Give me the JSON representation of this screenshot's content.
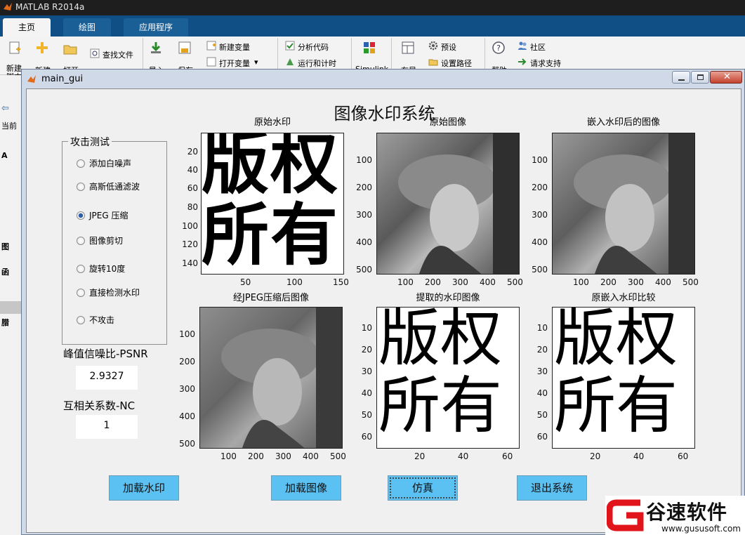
{
  "app": {
    "title": "MATLAB R2014a"
  },
  "ribbon": {
    "tabs": [
      "主页",
      "绘图",
      "应用程序"
    ],
    "items": {
      "new_script": "新建\n脚本",
      "new": "新建",
      "open": "打开",
      "find_files": "查找文件",
      "import": "导入",
      "save": "保存",
      "new_variable": "新建变量",
      "open_variable": "打开变量",
      "analyze_code": "分析代码",
      "run_time": "运行和计时",
      "simulink": "Simulink",
      "layout": "布局",
      "preferences": "预设",
      "set_path": "设置路径",
      "help": "帮助",
      "community": "社区",
      "request_support": "请求支持"
    }
  },
  "side": {
    "current": "当前",
    "a": "A",
    "fig": "图",
    "fn": "函",
    "bad": "腊"
  },
  "window": {
    "title": "main_gui"
  },
  "gui": {
    "heading": "图像水印系统",
    "attack_group": "攻击测试",
    "radios": [
      {
        "label": "添加白噪声",
        "selected": false
      },
      {
        "label": "高斯低通滤波",
        "selected": false
      },
      {
        "label": "JPEG 压缩",
        "selected": true
      },
      {
        "label": "图像剪切",
        "selected": false
      },
      {
        "label": "旋转10度",
        "selected": false
      },
      {
        "label": "直接检测水印",
        "selected": false
      },
      {
        "label": "不攻击",
        "selected": false
      }
    ],
    "psnr_label": "峰值信噪比-PSNR",
    "psnr_value": "2.9327",
    "nc_label": "互相关系数-NC",
    "nc_value": "1",
    "buttons": [
      "加载水印",
      "加载图像",
      "仿真",
      "退出系统"
    ],
    "axes": [
      {
        "title": "原始水印",
        "yticks": [
          "20",
          "40",
          "60",
          "80",
          "100",
          "120",
          "140"
        ],
        "xticks": [
          "50",
          "100",
          "150"
        ]
      },
      {
        "title": "原始图像",
        "yticks": [
          "100",
          "200",
          "300",
          "400",
          "500"
        ],
        "xticks": [
          "100",
          "200",
          "300",
          "400",
          "500"
        ]
      },
      {
        "title": "嵌入水印后的图像",
        "yticks": [
          "100",
          "200",
          "300",
          "400",
          "500"
        ],
        "xticks": [
          "100",
          "200",
          "300",
          "400",
          "500"
        ]
      },
      {
        "title": "经JPEG压缩后图像",
        "yticks": [
          "100",
          "200",
          "300",
          "400",
          "500"
        ],
        "xticks": [
          "100",
          "200",
          "300",
          "400",
          "500"
        ]
      },
      {
        "title": "提取的水印图像",
        "yticks": [
          "10",
          "20",
          "30",
          "40",
          "50",
          "60"
        ],
        "xticks": [
          "20",
          "40",
          "60"
        ]
      },
      {
        "title": "原嵌入水印比较",
        "yticks": [
          "10",
          "20",
          "30",
          "40",
          "50",
          "60"
        ],
        "xticks": [
          "20",
          "40",
          "60"
        ]
      }
    ],
    "watermark_text": [
      "版",
      "权",
      "所",
      "有"
    ]
  },
  "logo": {
    "brand": "谷速软件",
    "url": "www.gususoft.com"
  }
}
